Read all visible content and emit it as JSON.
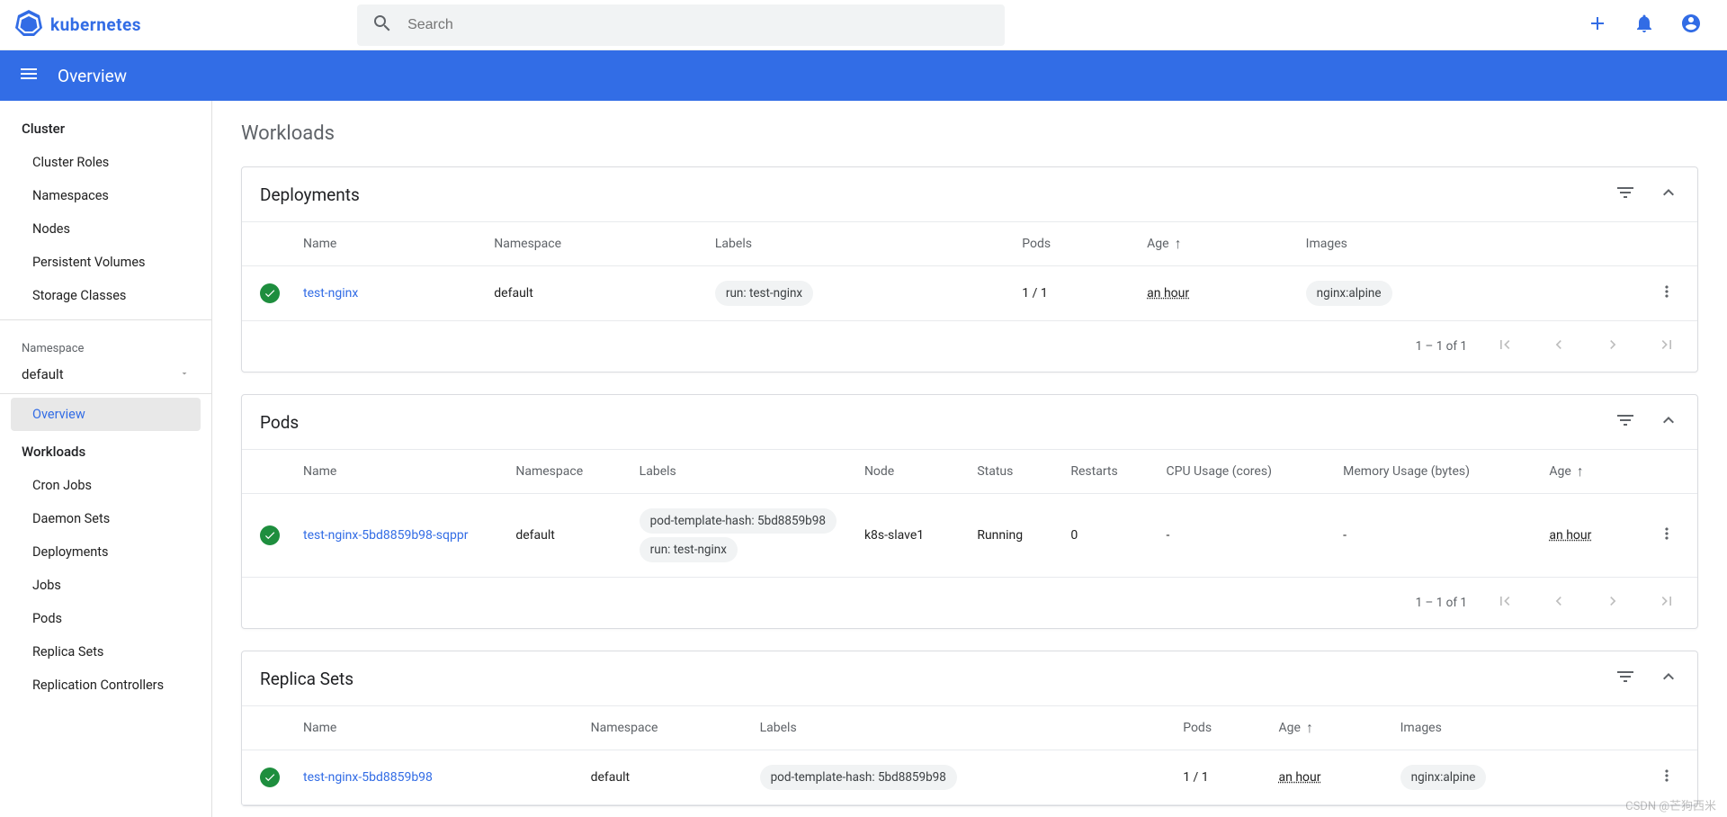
{
  "brand": "kubernetes",
  "search": {
    "placeholder": "Search"
  },
  "bluebar": {
    "title": "Overview"
  },
  "sidebar": {
    "cluster_heading": "Cluster",
    "cluster_items": [
      "Cluster Roles",
      "Namespaces",
      "Nodes",
      "Persistent Volumes",
      "Storage Classes"
    ],
    "namespace_label": "Namespace",
    "namespace_value": "default",
    "overview": "Overview",
    "workloads_heading": "Workloads",
    "workloads_items": [
      "Cron Jobs",
      "Daemon Sets",
      "Deployments",
      "Jobs",
      "Pods",
      "Replica Sets",
      "Replication Controllers"
    ]
  },
  "page_title": "Workloads",
  "deployments": {
    "title": "Deployments",
    "headers": {
      "name": "Name",
      "namespace": "Namespace",
      "labels": "Labels",
      "pods": "Pods",
      "age": "Age",
      "images": "Images"
    },
    "rows": [
      {
        "name": "test-nginx",
        "namespace": "default",
        "labels": [
          "run: test-nginx"
        ],
        "pods": "1 / 1",
        "age": "an hour",
        "images": [
          "nginx:alpine"
        ]
      }
    ],
    "pager": "1 – 1 of 1"
  },
  "pods": {
    "title": "Pods",
    "headers": {
      "name": "Name",
      "namespace": "Namespace",
      "labels": "Labels",
      "node": "Node",
      "status": "Status",
      "restarts": "Restarts",
      "cpu": "CPU Usage (cores)",
      "mem": "Memory Usage (bytes)",
      "age": "Age"
    },
    "rows": [
      {
        "name": "test-nginx-5bd8859b98-sqppr",
        "namespace": "default",
        "labels": [
          "pod-template-hash: 5bd8859b98",
          "run: test-nginx"
        ],
        "node": "k8s-slave1",
        "status": "Running",
        "restarts": "0",
        "cpu": "-",
        "mem": "-",
        "age": "an hour"
      }
    ],
    "pager": "1 – 1 of 1"
  },
  "replicasets": {
    "title": "Replica Sets",
    "headers": {
      "name": "Name",
      "namespace": "Namespace",
      "labels": "Labels",
      "pods": "Pods",
      "age": "Age",
      "images": "Images"
    },
    "rows": [
      {
        "name": "test-nginx-5bd8859b98",
        "namespace": "default",
        "labels": [
          "pod-template-hash: 5bd8859b98"
        ],
        "pods": "1 / 1",
        "age": "an hour",
        "images": [
          "nginx:alpine"
        ]
      }
    ]
  },
  "watermark": "CSDN @芒狗西米"
}
